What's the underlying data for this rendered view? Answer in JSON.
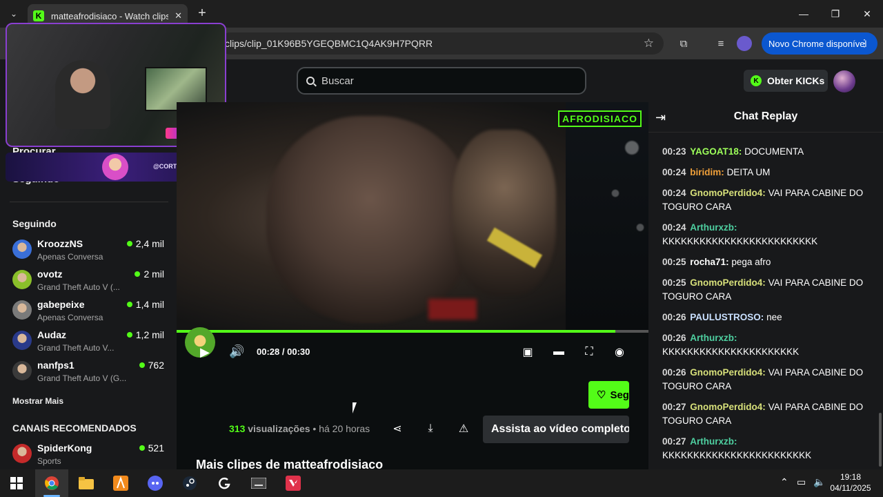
{
  "browser": {
    "tab_title": "matteafrodisiaco - Watch clips",
    "tab_favicon": "K",
    "url": "clips/clip_01K96B5YGEQBMC1Q4AK9H7PQRR",
    "update_button": "Novo Chrome disponível",
    "icons": [
      "tab-list-icon",
      "close-icon",
      "plus-icon",
      "minimize-icon",
      "maximize-icon",
      "window-close-icon",
      "star-icon",
      "extensions-icon",
      "media-icon",
      "profile-icon",
      "more-icon"
    ]
  },
  "header": {
    "search_placeholder": "Buscar",
    "kicks_button": "Obter KICKs"
  },
  "sidebar": {
    "nav": [
      "Procurar",
      "Seguindo"
    ],
    "following_heading": "Seguindo",
    "following": [
      {
        "name": "KroozzNS",
        "category": "Apenas Conversa",
        "viewers": "2,4 mil",
        "color": "#3a6fd8"
      },
      {
        "name": "ovotz",
        "category": "Grand Theft Auto V (...",
        "viewers": "2 mil",
        "color": "#8abf2a"
      },
      {
        "name": "gabepeixe",
        "category": "Apenas Conversa",
        "viewers": "1,4 mil",
        "color": "#7a7a7a"
      },
      {
        "name": "Audaz",
        "category": "Grand Theft Auto V...",
        "viewers": "1,2 mil",
        "color": "#2a3a8a"
      },
      {
        "name": "nanfps1",
        "category": "Grand Theft Auto V (G...",
        "viewers": "762",
        "color": "#3a3a3a"
      }
    ],
    "show_more": "Mostrar Mais",
    "recommended_heading": "CANAIS RECOMENDADOS",
    "recommended": [
      {
        "name": "SpiderKong",
        "category": "Sports",
        "viewers": "521",
        "color": "#c42a2a"
      }
    ]
  },
  "webcam": {
    "handle": "@CORTESGALEGUINS"
  },
  "player": {
    "watermark": "AFRODISIACO",
    "current_time": "00:28",
    "separator": "/",
    "duration": "00:30",
    "progress": 0.93
  },
  "clip": {
    "follow_label": "Seguir",
    "views": "313",
    "views_label": "visualizações",
    "age": "• há 20 horas",
    "watch_full": "Assista ao vídeo completo",
    "more_clips": "Mais clipes de matteafrodisiaco"
  },
  "chat": {
    "title": "Chat Replay",
    "messages": [
      {
        "time": "00:23",
        "user": "YAGOAT18:",
        "text": "DOCUMENTA",
        "color": "#9dff5a"
      },
      {
        "time": "00:24",
        "user": "biridim:",
        "text": "DEITA UM",
        "color": "#f0a03a"
      },
      {
        "time": "00:24",
        "user": "GnomoPerdido4:",
        "text": "VAI PARA CABINE DO TOGURO CARA",
        "color": "#d7e07a"
      },
      {
        "time": "00:24",
        "user": "Arthurxzb:",
        "text": "KKKKKKKKKKKKKKKKKKKKKKKKK",
        "color": "#4ecfa0"
      },
      {
        "time": "00:25",
        "user": "rocha71:",
        "text": "pega afro",
        "color": "#ffffff"
      },
      {
        "time": "00:25",
        "user": "GnomoPerdido4:",
        "text": "VAI PARA CABINE DO TOGURO CARA",
        "color": "#d7e07a"
      },
      {
        "time": "00:26",
        "user": "PAULUSTROSO:",
        "text": "nee",
        "color": "#c9e0ff"
      },
      {
        "time": "00:26",
        "user": "Arthurxzb:",
        "text": "KKKKKKKKKKKKKKKKKKKKKK",
        "color": "#4ecfa0"
      },
      {
        "time": "00:26",
        "user": "GnomoPerdido4:",
        "text": "VAI PARA CABINE DO TOGURO CARA",
        "color": "#d7e07a"
      },
      {
        "time": "00:27",
        "user": "GnomoPerdido4:",
        "text": "VAI PARA CABINE DO TOGURO CARA",
        "color": "#d7e07a"
      },
      {
        "time": "00:27",
        "user": "Arthurxzb:",
        "text": "KKKKKKKKKKKKKKKKKKKKKKKK",
        "color": "#4ecfa0"
      }
    ]
  },
  "taskbar": {
    "apps": [
      "windows-start-icon",
      "chrome-icon",
      "file-explorer-icon",
      "game-launcher-icon",
      "discord-icon",
      "steam-icon",
      "g-hub-icon",
      "keyboard-app-icon",
      "valorant-icon"
    ],
    "time": "19:18",
    "date": "04/11/2025"
  },
  "colors": {
    "kick_green": "#53fc18",
    "chrome_blue": "#0b57d0",
    "panel_bg": "#18191b"
  }
}
